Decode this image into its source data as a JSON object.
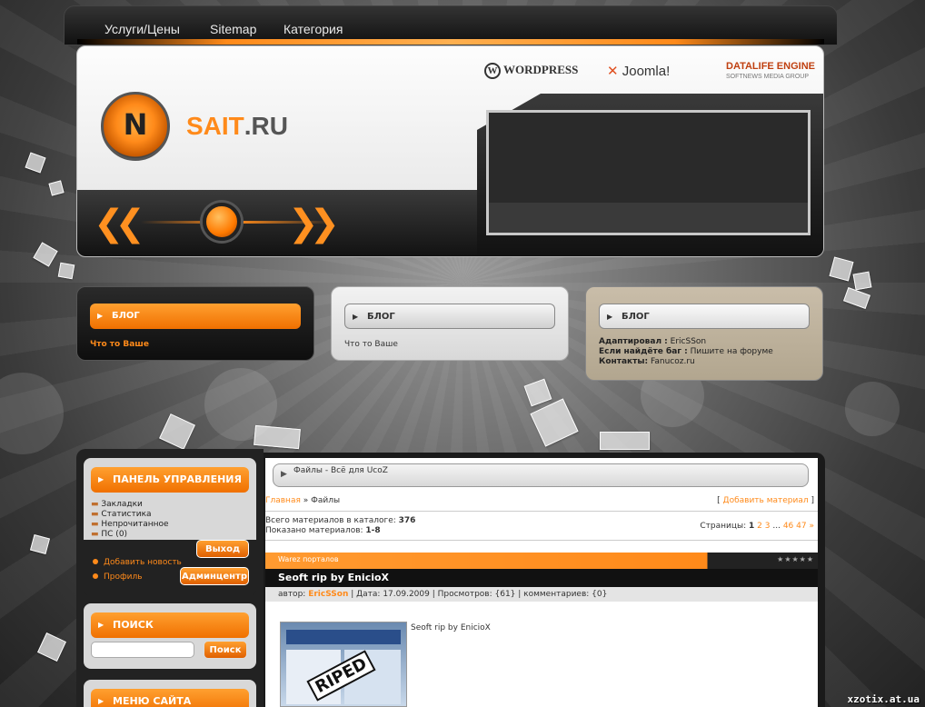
{
  "nav": {
    "links": [
      "Услуги/Цены",
      "Sitemap",
      "Категория"
    ]
  },
  "header": {
    "site_name_main": "SAIT",
    "site_name_tld": ".RU",
    "logo_letter": "N",
    "brands": [
      "WORDPRESS",
      "Joomla!",
      "DATALIFE ENGINE"
    ],
    "brand_sub": "SOFTNEWS MEDIA GROUP"
  },
  "blogs": [
    {
      "title": "БЛОГ",
      "text": "Что то Ваше"
    },
    {
      "title": "БЛОГ",
      "text": "Что то Ваше"
    },
    {
      "title": "БЛОГ",
      "lines": [
        {
          "label": "Адаптировал :",
          "value": "EricSSon"
        },
        {
          "label": "Если найдёте баг :",
          "value": "Пишите на форуме"
        },
        {
          "label": "Контакты:",
          "value": "Fanucoz.ru"
        }
      ]
    }
  ],
  "control_panel": {
    "title": "ПАНЕЛЬ УПРАВЛЕНИЯ",
    "items": [
      "Закладки",
      "Статистика",
      "Непрочитанное",
      "ПС (0)"
    ],
    "logout": "Выход",
    "links": [
      "Добавить новость",
      "Профиль"
    ],
    "admin": "Админцентр"
  },
  "search": {
    "title": "ПОИСК",
    "button": "Поиск",
    "placeholder": ""
  },
  "menu": {
    "title": "МЕНЮ САЙТА"
  },
  "main": {
    "crumb_title": "Файлы - Всё для UcoZ",
    "breadcrumb_home": "Главная",
    "breadcrumb_sep": "»",
    "breadcrumb_current": "Файлы",
    "add_material": "Добавить материал",
    "total_label": "Всего материалов в каталоге:",
    "total_value": "376",
    "shown_label": "Показано материалов:",
    "shown_value": "1-8",
    "pages_label": "Страницы:",
    "pages": [
      "1",
      "2",
      "3",
      "...",
      "46",
      "47",
      "»"
    ],
    "category": "Warez порталов",
    "post_title": "Seoft rip by EnicioX",
    "meta_author_label": "автор:",
    "meta_author": "EricSSon",
    "meta_rest": "| Дата: 17.09.2009 | Просмотров: {61} | комментариев: {0}",
    "post_text": "Seoft rip by EnicioX",
    "thumb_stamp": "RIPED"
  },
  "watermark": "xzotix.at.ua",
  "colors": {
    "accent": "#ff8a1a",
    "dark": "#1a1a1a"
  }
}
